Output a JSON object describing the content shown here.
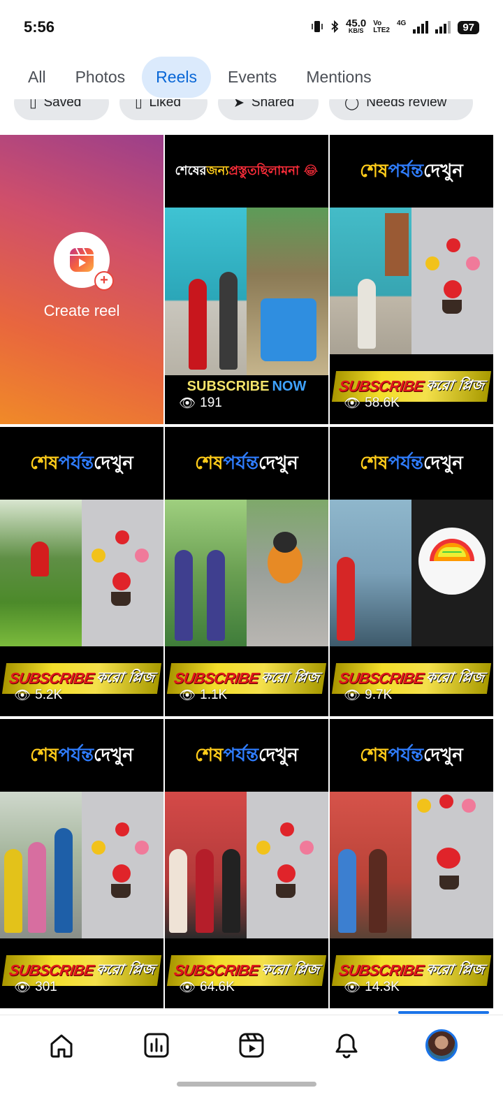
{
  "status_bar": {
    "time": "5:56",
    "net_speed": "45.0",
    "net_unit": "KB/S",
    "volte_top": "Vo",
    "volte_bottom": "LTE2",
    "network": "4G",
    "battery": "97"
  },
  "tabs": [
    {
      "label": "All",
      "active": false
    },
    {
      "label": "Photos",
      "active": false
    },
    {
      "label": "Reels",
      "active": true
    },
    {
      "label": "Events",
      "active": false
    },
    {
      "label": "Mentions",
      "active": false
    }
  ],
  "chips": [
    "Saved",
    "Liked",
    "Shared",
    "Needs review"
  ],
  "create_reel": {
    "label": "Create reel"
  },
  "reels": [
    {
      "headline": [
        "শেষের ",
        "জন্য ",
        "প্রস্তুত ",
        "ছিলামনা 😂"
      ],
      "banner_left": "SUBSCRIBE",
      "banner_right": "NOW",
      "views": "191"
    },
    {
      "headline": [
        "শেষ ",
        "পর্যন্ত ",
        "দেখুন"
      ],
      "banner_left": "SUBSCRIBE",
      "banner_right": "করো প্লিজ",
      "views": "58.6K"
    },
    {
      "headline": [
        "শেষ ",
        "পর্যন্ত ",
        "দেখুন"
      ],
      "banner_left": "SUBSCRIBE",
      "banner_right": "করো প্লিজ",
      "views": "5.2K"
    },
    {
      "headline": [
        "শেষ ",
        "পর্যন্ত ",
        "দেখুন"
      ],
      "banner_left": "SUBSCRIBE",
      "banner_right": "করো প্লিজ",
      "views": "1.1K"
    },
    {
      "headline": [
        "শেষ ",
        "পর্যন্ত ",
        "দেখুন"
      ],
      "banner_left": "SUBSCRIBE",
      "banner_right": "করো প্লিজ",
      "views": "9.7K"
    },
    {
      "headline": [
        "শেষ ",
        "পর্যন্ত ",
        "দেখুন"
      ],
      "banner_left": "SUBSCRIBE",
      "banner_right": "করো প্লিজ",
      "views": "301"
    },
    {
      "headline": [
        "শেষ ",
        "পর্যন্ত ",
        "দেখুন"
      ],
      "banner_left": "SUBSCRIBE",
      "banner_right": "করো প্লিজ",
      "views": "64.6K"
    },
    {
      "headline": [
        "শেষ ",
        "পর্যন্ত ",
        "দেখুন"
      ],
      "banner_left": "SUBSCRIBE",
      "banner_right": "করো প্লিজ",
      "views": "14.3K"
    }
  ],
  "bottom_nav": [
    {
      "icon": "home-icon",
      "active": false
    },
    {
      "icon": "dashboard-icon",
      "active": false
    },
    {
      "icon": "reels-icon",
      "active": false
    },
    {
      "icon": "bell-icon",
      "active": false
    },
    {
      "icon": "profile-avatar",
      "active": true
    }
  ],
  "colors": {
    "accent": "#0866d6",
    "active_tab_bg": "#dbeafc",
    "headline_yellow": "#ffcc1a",
    "headline_blue": "#2f7dff",
    "banner_red": "#e0161b"
  }
}
